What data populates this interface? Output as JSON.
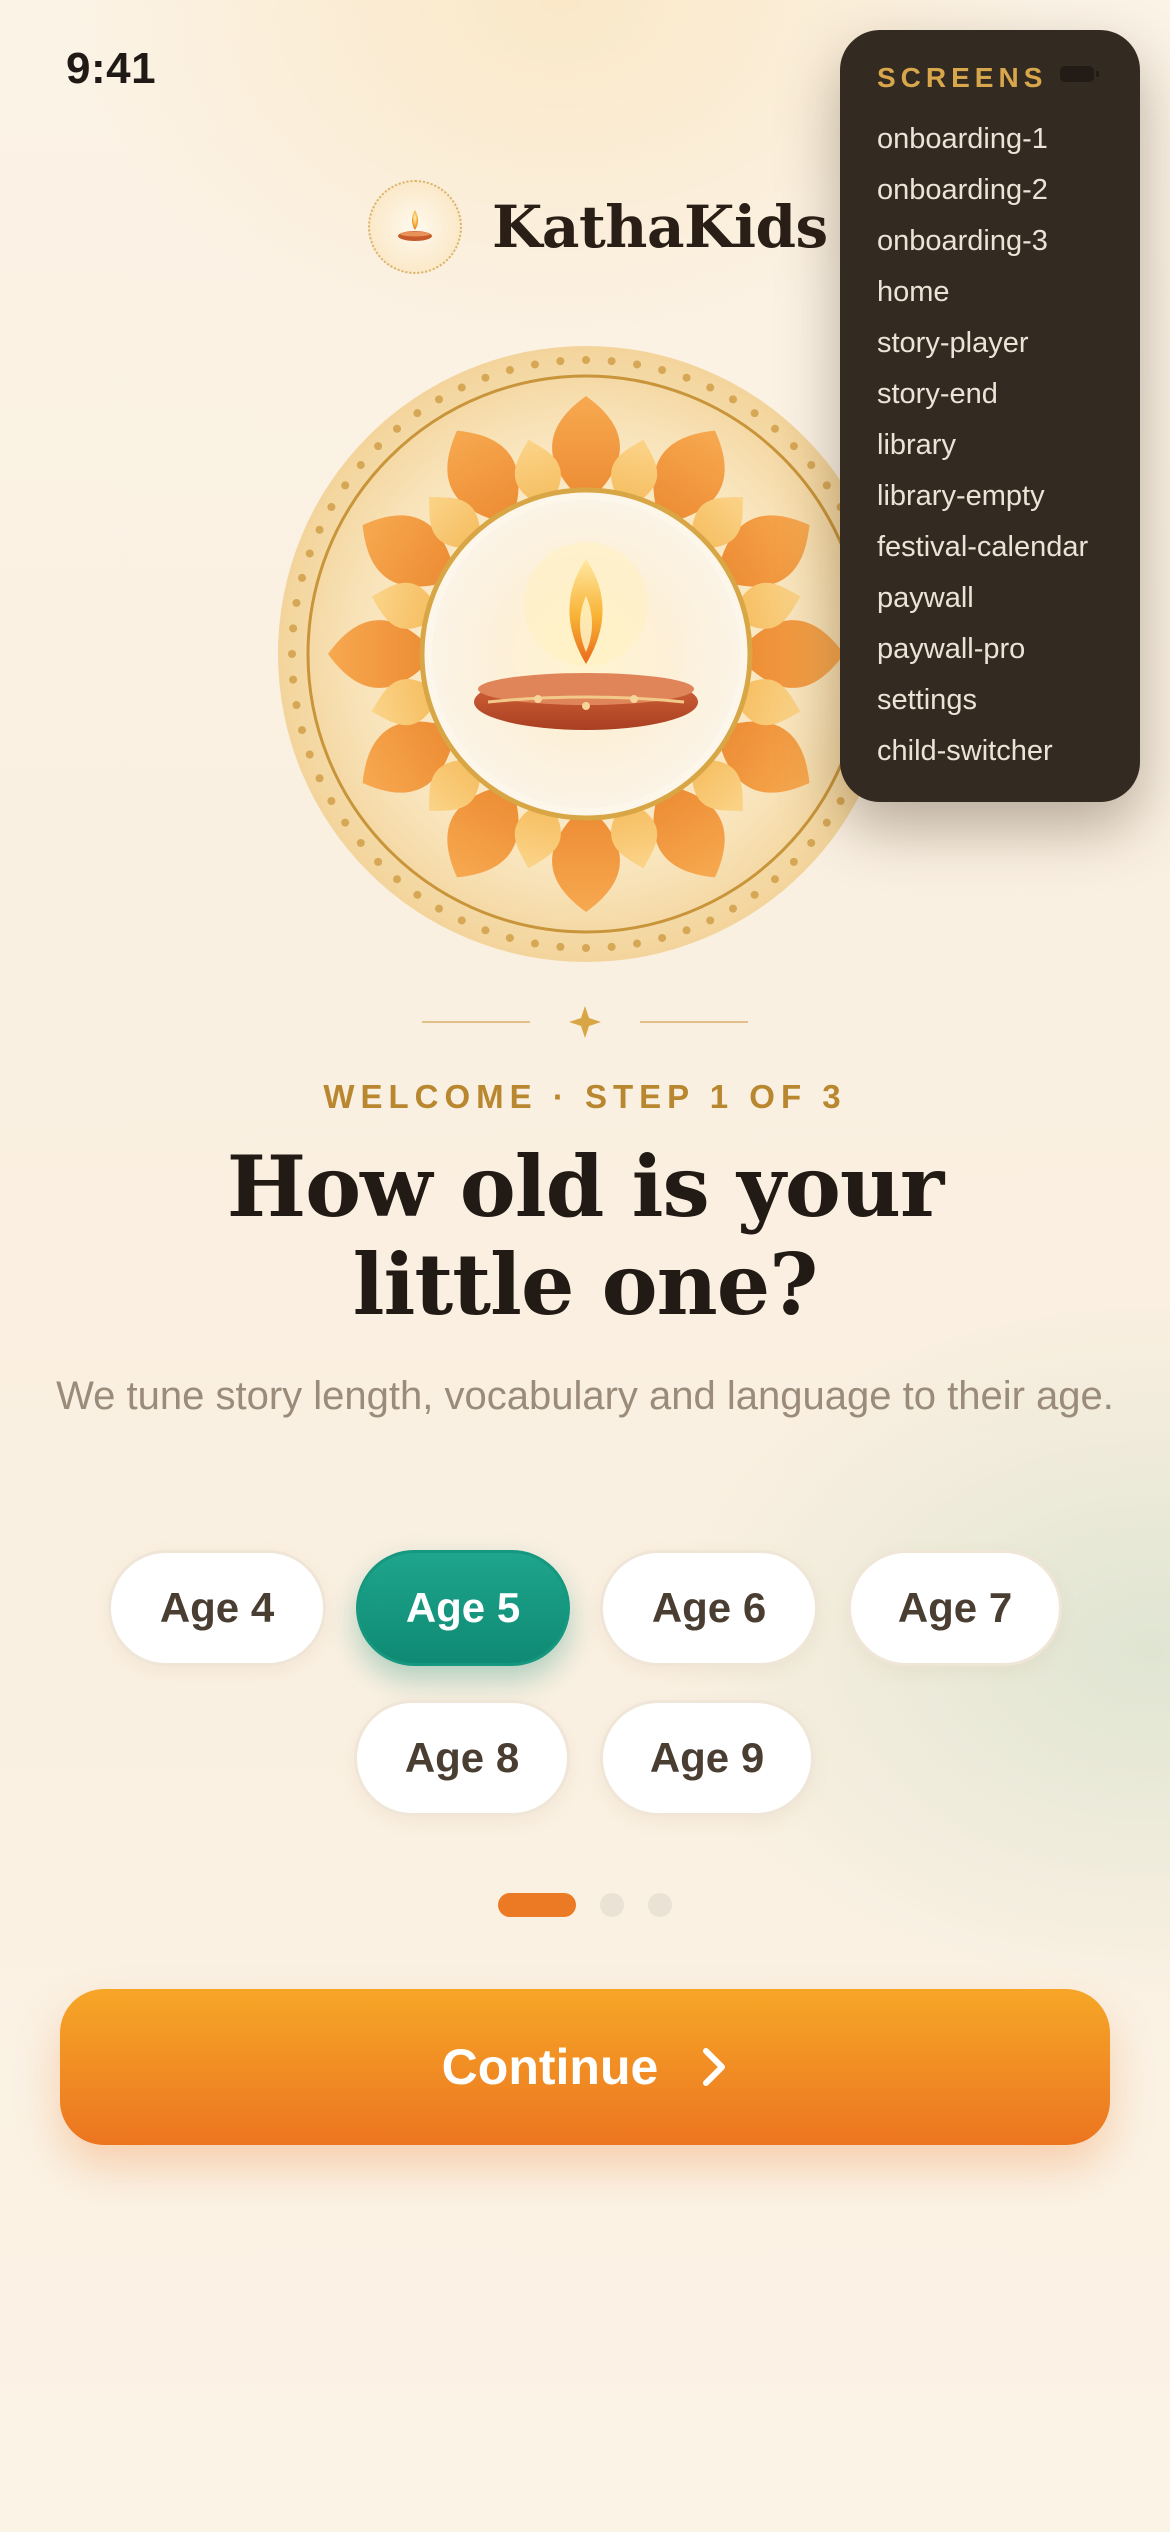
{
  "status_bar": {
    "time": "9:41"
  },
  "brand": {
    "name": "KathaKids"
  },
  "illustration": {
    "name": "diya-lotus-mandala"
  },
  "onboarding": {
    "eyebrow": "WELCOME · STEP 1 OF 3",
    "title_line1": "How old is your",
    "title_line2": "little one?",
    "subtitle": "We tune story length, vocabulary and language to their age.",
    "age_options": [
      {
        "label": "Age 4",
        "selected": false
      },
      {
        "label": "Age 5",
        "selected": true
      },
      {
        "label": "Age 6",
        "selected": false
      },
      {
        "label": "Age 7",
        "selected": false
      },
      {
        "label": "Age 8",
        "selected": false
      },
      {
        "label": "Age 9",
        "selected": false
      }
    ],
    "pager": {
      "current": 1,
      "total": 3
    },
    "continue_label": "Continue"
  },
  "screens_panel": {
    "title": "SCREENS",
    "items": [
      "onboarding-1",
      "onboarding-2",
      "onboarding-3",
      "home",
      "story-player",
      "story-end",
      "library",
      "library-empty",
      "festival-calendar",
      "paywall",
      "paywall-pro",
      "settings",
      "child-switcher"
    ]
  },
  "colors": {
    "accent_orange": "#ec7a24",
    "accent_teal": "#16977f",
    "gold": "#b9872f",
    "background": "#faf1e4",
    "panel": "#332a22"
  },
  "icons": {
    "continue": "chevron-right-icon",
    "logo": "diya-icon",
    "divider": "sparkle-icon"
  }
}
